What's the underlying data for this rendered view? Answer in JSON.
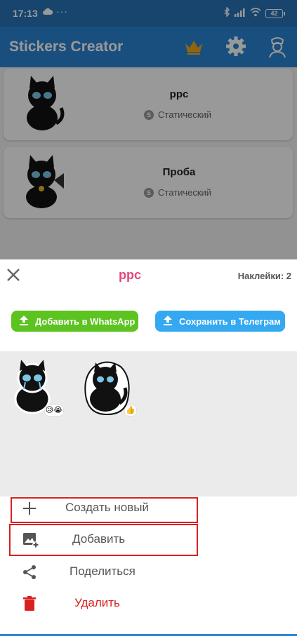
{
  "status_bar": {
    "time": "17:13",
    "dots": "···",
    "battery": "42"
  },
  "app_bar": {
    "title": "Stickers Creator"
  },
  "packs": [
    {
      "name": "ррс",
      "type": "Статический"
    },
    {
      "name": "Проба",
      "type": "Статический"
    }
  ],
  "sheet": {
    "title": "ррс",
    "sticker_count": "Наклейки: 2",
    "whatsapp_label": "Добавить в WhatsApp",
    "telegram_label": "Сохранить в Телеграм",
    "stickers": [
      {
        "emoji": "😥😭"
      },
      {
        "emoji": "👍"
      }
    ],
    "menu": {
      "create_label": "Создать новый",
      "add_label": "Добавить",
      "share_label": "Поделиться",
      "delete_label": "Удалить"
    }
  },
  "colors": {
    "app_bar": "#2b84d2",
    "status_bar": "#2773b8",
    "sheet_title": "#e5467e",
    "whatsapp": "#5cc320",
    "telegram": "#35a8f2",
    "delete": "#d9201f",
    "highlight": "#d9201f"
  },
  "icons": {
    "status": [
      "cloud-icon",
      "bluetooth-icon",
      "signal-icon",
      "wifi-icon",
      "battery-icon"
    ],
    "app_bar": [
      "crown-icon",
      "gear-icon",
      "nurse-icon"
    ],
    "sheet": [
      "close-icon",
      "upload-icon"
    ],
    "menu": [
      "plus-icon",
      "add-image-icon",
      "share-icon",
      "trash-icon"
    ]
  }
}
